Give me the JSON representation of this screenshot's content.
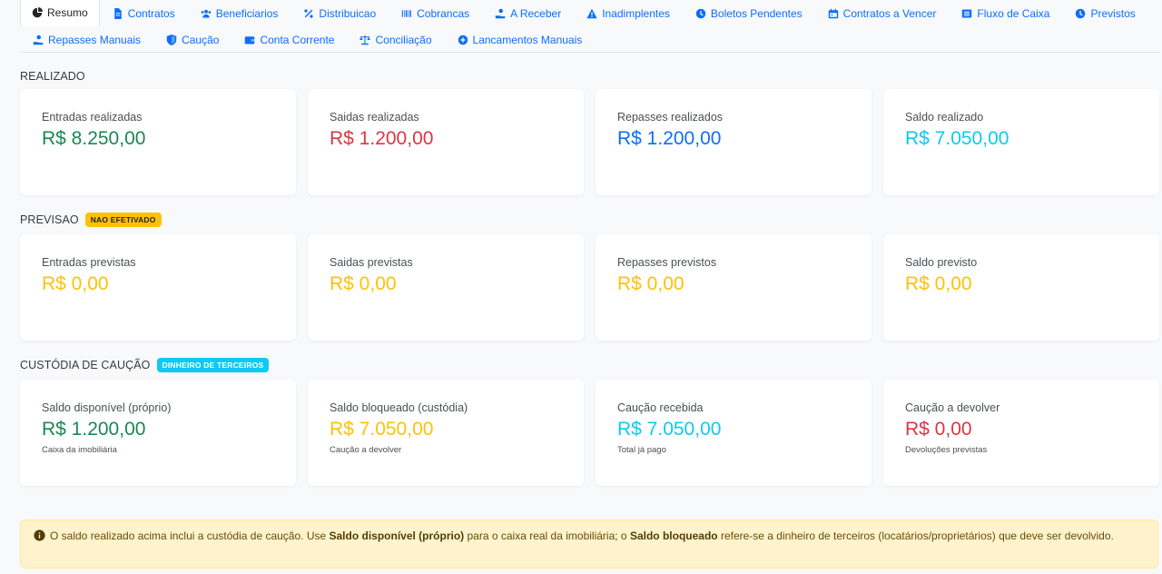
{
  "tabs": {
    "row1": [
      {
        "label": "Resumo",
        "icon": "pie-chart-icon",
        "active": true
      },
      {
        "label": "Contratos",
        "icon": "file-icon"
      },
      {
        "label": "Beneficiarios",
        "icon": "users-icon"
      },
      {
        "label": "Distribuicao",
        "icon": "percent-icon"
      },
      {
        "label": "Cobrancas",
        "icon": "barcode-icon"
      },
      {
        "label": "A Receber",
        "icon": "hand-coin-icon"
      },
      {
        "label": "Inadimplentes",
        "icon": "warning-icon"
      },
      {
        "label": "Boletos Pendentes",
        "icon": "clock-icon"
      },
      {
        "label": "Contratos a Vencer",
        "icon": "calendar-icon"
      },
      {
        "label": "Fluxo de Caixa",
        "icon": "list-icon"
      },
      {
        "label": "Previstos",
        "icon": "clock-icon"
      }
    ],
    "row2": [
      {
        "label": "Repasses Manuais",
        "icon": "hand-coin-icon"
      },
      {
        "label": "Caução",
        "icon": "shield-icon"
      },
      {
        "label": "Conta Corrente",
        "icon": "wallet-icon"
      },
      {
        "label": "Conciliação",
        "icon": "scale-icon"
      },
      {
        "label": "Lancamentos Manuais",
        "icon": "plus-circle-icon"
      }
    ]
  },
  "sections": {
    "realizado": {
      "title": "REALIZADO",
      "cards": [
        {
          "label": "Entradas realizadas",
          "value": "R$ 8.250,00",
          "color": "#198754"
        },
        {
          "label": "Saidas realizadas",
          "value": "R$ 1.200,00",
          "color": "#dc3545"
        },
        {
          "label": "Repasses realizados",
          "value": "R$ 1.200,00",
          "color": "#0d6efd"
        },
        {
          "label": "Saldo realizado",
          "value": "R$ 7.050,00",
          "color": "#0dcaf0"
        }
      ]
    },
    "previsao": {
      "title": "PREVISAO",
      "badge": "NAO EFETIVADO",
      "cards": [
        {
          "label": "Entradas previstas",
          "value": "R$ 0,00",
          "color": "#ffc107"
        },
        {
          "label": "Saidas previstas",
          "value": "R$ 0,00",
          "color": "#ffc107"
        },
        {
          "label": "Repasses previstos",
          "value": "R$ 0,00",
          "color": "#ffc107"
        },
        {
          "label": "Saldo previsto",
          "value": "R$ 0,00",
          "color": "#ffc107"
        }
      ]
    },
    "custodia": {
      "title": "CUSTÓDIA DE CAUÇÃO",
      "badge": "DINHEIRO DE TERCEIROS",
      "cards": [
        {
          "label": "Saldo disponível (próprio)",
          "value": "R$ 1.200,00",
          "sub": "Caixa da imobiliária",
          "color": "#198754"
        },
        {
          "label": "Saldo bloqueado (custódia)",
          "value": "R$ 7.050,00",
          "sub": "Caução a devolver",
          "color": "#ffc107"
        },
        {
          "label": "Caução recebida",
          "value": "R$ 7.050,00",
          "sub": "Total já pago",
          "color": "#0dcaf0"
        },
        {
          "label": "Caução a devolver",
          "value": "R$ 0,00",
          "sub": "Devoluções previstas",
          "color": "#dc3545"
        }
      ]
    }
  },
  "alert": {
    "icon": "info-circle-icon",
    "t1": "O saldo realizado acima inclui a custódia de caução. Use ",
    "b1": "Saldo disponível (próprio)",
    "t2": " para o caixa real da imobiliária; o ",
    "b2": "Saldo bloqueado",
    "t3": " refere-se a dinheiro de terceiros (locatários/proprietários) que deve ser devolvido."
  }
}
